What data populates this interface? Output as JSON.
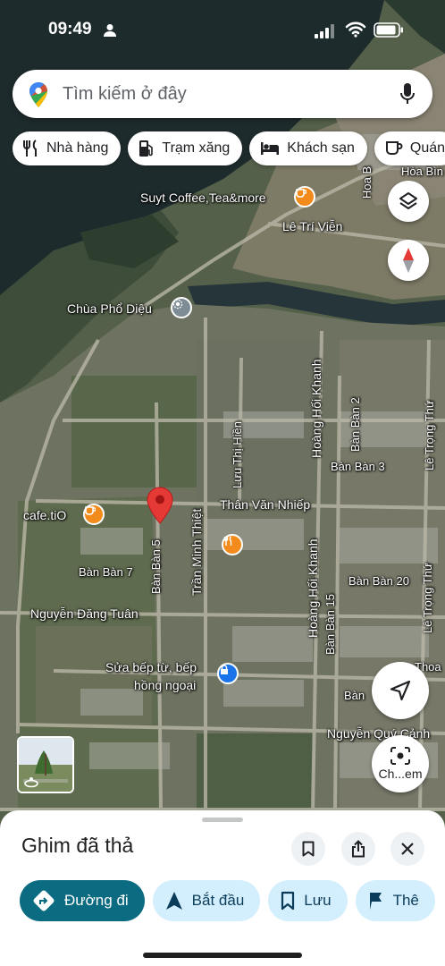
{
  "status_bar": {
    "time": "09:49"
  },
  "search": {
    "placeholder": "Tìm kiếm ở đây"
  },
  "chips": [
    {
      "label": "Nhà hàng",
      "icon": "fork-knife-icon"
    },
    {
      "label": "Trạm xăng",
      "icon": "gas-pump-icon"
    },
    {
      "label": "Khách sạn",
      "icon": "bed-icon"
    },
    {
      "label": "Quán",
      "icon": "coffee-cup-icon"
    }
  ],
  "map": {
    "labels": {
      "suyt_coffee": "Suyt Coffee,Tea&more",
      "le_tri_vien": "Lê Trí Viễn",
      "chua_pho_dieu": "Chùa Phổ Diệu",
      "hoa_b": "Hoa B",
      "hoa_binh": "Hòa Bìn",
      "cafe_tio": "cafe.tiO",
      "than_van_nhiep": "Thân Văn Nhiếp",
      "ban_ban_7": "Bàn Bàn 7",
      "ban_ban_5": "Bàn Bàn 5",
      "tran_minh_thiet": "Trần Minh Thiệt",
      "luu_thi_hien": "Lưu Thị Hiền",
      "hoang_hoi_khanh_top": "Hoàng Hối Khanh",
      "hoang_hoi_khanh_bottom": "Hoàng Hối Khanh",
      "ban_ban_2": "Bàn Bàn 2",
      "ban_ban_3": "Bàn Bàn 3",
      "ban_ban_15": "Bàn Bàn 15",
      "ban_ban_20": "Bàn Bàn 20",
      "le_trong_thu_top": "Lê Trọng Thứ",
      "le_trong_thu_bottom": "Lê Trọng Thứ",
      "nguyen_dang_tuan": "Nguyễn Đăng Tuân",
      "sua_bep_tu": "Sửa bếp từ, bếp",
      "hong_ngoai": "hồng ngoại",
      "nguyen_quy_canh": "Nguyễn Quý Cảnh",
      "thoa": "Thoa",
      "ban": "Bàn"
    }
  },
  "controls": {
    "street_view_label": "Ch...em"
  },
  "sheet": {
    "title": "Ghim đã thả"
  },
  "actions": [
    {
      "label": "Đường đi",
      "icon": "directions-icon"
    },
    {
      "label": "Bắt đầu",
      "icon": "navigation-arrow-icon"
    },
    {
      "label": "Lưu",
      "icon": "bookmark-icon"
    },
    {
      "label": "Thê",
      "icon": "flag-icon"
    }
  ],
  "colors": {
    "pin": "#e53935",
    "poi_orange": "#f28b1b",
    "poi_blue": "#1a73e8",
    "primary_button": "#0b6b80",
    "action_bg": "#d3eefc"
  }
}
